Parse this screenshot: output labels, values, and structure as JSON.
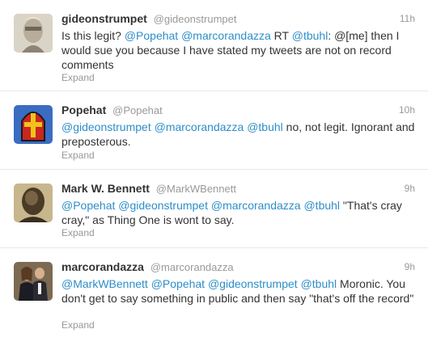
{
  "tweets": [
    {
      "fullname": "gideonstrumpet",
      "username": "@gideonstrumpet",
      "time": "11h",
      "avatar": "portrait-photo",
      "text": [
        {
          "t": "Is this legit? ",
          "m": false
        },
        {
          "t": "@Popehat",
          "m": true
        },
        {
          "t": " ",
          "m": false
        },
        {
          "t": "@marcorandazza",
          "m": true
        },
        {
          "t": " RT ",
          "m": false
        },
        {
          "t": "@tbuhl",
          "m": true
        },
        {
          "t": ": @[me] then I would sue you because I have stated my tweets are not on record comments",
          "m": false
        }
      ],
      "expand": "Expand"
    },
    {
      "fullname": "Popehat",
      "username": "@Popehat",
      "time": "10h",
      "avatar": "pope-hat-icon",
      "text": [
        {
          "t": "@gideonstrumpet",
          "m": true
        },
        {
          "t": " ",
          "m": false
        },
        {
          "t": "@marcorandazza",
          "m": true
        },
        {
          "t": " ",
          "m": false
        },
        {
          "t": "@tbuhl",
          "m": true
        },
        {
          "t": " no, not legit. Ignorant and preposterous.",
          "m": false
        }
      ],
      "expand": "Expand"
    },
    {
      "fullname": "Mark W. Bennett",
      "username": "@MarkWBennett",
      "time": "9h",
      "avatar": "sculpture-photo",
      "text": [
        {
          "t": "@Popehat",
          "m": true
        },
        {
          "t": " ",
          "m": false
        },
        {
          "t": "@gideonstrumpet",
          "m": true
        },
        {
          "t": " ",
          "m": false
        },
        {
          "t": "@marcorandazza",
          "m": true
        },
        {
          "t": " ",
          "m": false
        },
        {
          "t": "@tbuhl",
          "m": true
        },
        {
          "t": " \"That's cray cray,\" as Thing One is wont to say.",
          "m": false
        }
      ],
      "expand": "Expand"
    },
    {
      "fullname": "marcorandazza",
      "username": "@marcorandazza",
      "time": "9h",
      "avatar": "couple-photo",
      "text": [
        {
          "t": "@MarkWBennett",
          "m": true
        },
        {
          "t": " ",
          "m": false
        },
        {
          "t": "@Popehat",
          "m": true
        },
        {
          "t": " ",
          "m": false
        },
        {
          "t": "@gideonstrumpet",
          "m": true
        },
        {
          "t": " ",
          "m": false
        },
        {
          "t": "@tbuhl",
          "m": true
        },
        {
          "t": " Moronic. You don't get to say something in public and then say \"that's off the record\"",
          "m": false
        }
      ],
      "expand": "Expand"
    }
  ]
}
